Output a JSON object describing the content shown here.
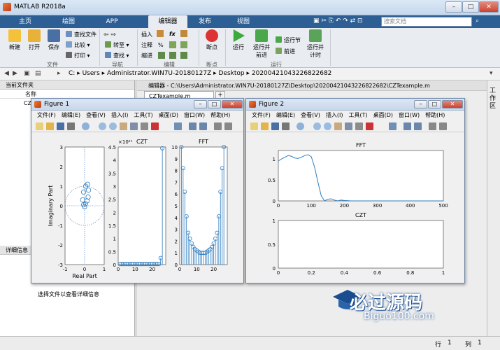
{
  "window": {
    "title": "MATLAB R2018a"
  },
  "ribbon_tabs": [
    {
      "label": "主页"
    },
    {
      "label": "绘图"
    },
    {
      "label": "APP"
    },
    {
      "label": "编辑器"
    },
    {
      "label": "发布"
    },
    {
      "label": "视图"
    }
  ],
  "search": {
    "placeholder": "搜索文档"
  },
  "ribbon": {
    "file": {
      "new": "新建",
      "open": "打开",
      "save": "保存",
      "find_files": "查找文件",
      "compare": "比较",
      "print": "打印",
      "group": "文件"
    },
    "nav": {
      "goto": "转至",
      "find": "查找",
      "group": "导航"
    },
    "edit": {
      "insert": "插入",
      "comment": "注释",
      "indent": "缩进",
      "fx": "fx",
      "pct": "%",
      "group": "编辑"
    },
    "breakpoints": {
      "label": "断点",
      "group": "断点"
    },
    "run": {
      "run": "运行",
      "run_advance": "运行并\n前进",
      "run_section": "运行节",
      "advance": "前进",
      "run_time": "运行并\n计时",
      "group": "运行"
    }
  },
  "address": {
    "segments": [
      "C:",
      "Users",
      "Administrator.WIN7U-20180127Z",
      "Desktop",
      "20200421043226822682"
    ]
  },
  "left_panel": {
    "header": "当前文件夹",
    "col_name": "名称",
    "item": "CZ",
    "details_header": "详细信息",
    "details_hint": "选择文件以查看详细信息"
  },
  "editor": {
    "header": "编辑器 - C:\\Users\\Administrator.WIN7U-20180127Z\\Desktop\\20200421043226822682\\CZTexample.m",
    "tab": "CZTexample.m",
    "add_tab": "+"
  },
  "right_strip": {
    "label": "工作区"
  },
  "status": {
    "row_label": "行",
    "row": "1",
    "col_label": "列",
    "col": "1"
  },
  "figure1": {
    "title": "Figure 1",
    "menus": [
      "文件(F)",
      "编辑(E)",
      "查看(V)",
      "插入(I)",
      "工具(T)",
      "桌面(D)",
      "窗口(W)",
      "帮助(H)"
    ]
  },
  "figure2": {
    "title": "Figure 2",
    "menus": [
      "文件(F)",
      "编辑(E)",
      "查看(V)",
      "插入(I)",
      "工具(T)",
      "桌面(D)",
      "窗口(W)",
      "帮助(H)"
    ]
  },
  "watermark": {
    "text": "必过源码",
    "sub": "Biguo100.com"
  },
  "chart_data": [
    {
      "type": "scatter",
      "title": "",
      "xlabel": "Real Part",
      "ylabel": "Imaginary Part",
      "xlim": [
        -1,
        1
      ],
      "ylim": [
        -3,
        3
      ],
      "xticks": [
        "-1",
        "0",
        "1"
      ],
      "yticks": [
        "3",
        "2",
        "1",
        "0",
        "-1",
        "-2",
        "-3"
      ],
      "series": [
        {
          "x": [
            0.05,
            0.12,
            0.18,
            0.2,
            0.15,
            0.05,
            -0.05,
            -0.1,
            -0.05,
            0.0
          ],
          "y": [
            0.1,
            0.25,
            0.45,
            0.8,
            1.1,
            1.0,
            0.7,
            0.3,
            0.05,
            -0.05
          ]
        }
      ],
      "annotations": [
        "unit circle (dotted)"
      ]
    },
    {
      "type": "line",
      "title": "CZT",
      "exponent": "×10²¹",
      "ylim": [
        0,
        4.5
      ],
      "xlim": [
        0,
        28
      ],
      "yticks": [
        "4.5",
        "4",
        "3.5",
        "3",
        "2.5",
        "2",
        "1.5",
        "1",
        "0.5",
        "0"
      ],
      "xticks": [
        "0",
        "10",
        "20"
      ],
      "stem": true,
      "x": [
        1,
        2,
        3,
        4,
        5,
        6,
        7,
        8,
        9,
        10,
        11,
        12,
        13,
        14,
        15,
        16,
        17,
        18,
        19,
        20,
        21,
        22,
        23,
        24,
        25,
        26
      ],
      "y": [
        0.02,
        0.02,
        0.02,
        0.02,
        0.02,
        0.02,
        0.02,
        0.02,
        0.02,
        0.02,
        0.02,
        0.02,
        0.02,
        0.02,
        0.02,
        0.02,
        0.02,
        0.02,
        0.02,
        0.02,
        0.02,
        0.02,
        0.02,
        0.02,
        0.25,
        4.45
      ]
    },
    {
      "type": "line",
      "title": "FFT",
      "ylim": [
        0,
        10
      ],
      "xlim": [
        0,
        28
      ],
      "yticks": [
        "10",
        "9",
        "8",
        "7",
        "6",
        "5",
        "4",
        "3",
        "2",
        "1",
        "0"
      ],
      "xticks": [
        "0",
        "10",
        "20"
      ],
      "stem": true,
      "x": [
        1,
        2,
        3,
        4,
        5,
        6,
        7,
        8,
        9,
        10,
        11,
        12,
        13,
        14,
        15,
        16,
        17,
        18,
        19,
        20,
        21,
        22,
        23,
        24,
        25,
        26
      ],
      "y": [
        10,
        8.2,
        6.2,
        4.1,
        2.7,
        2.2,
        1.8,
        1.5,
        1.3,
        1.2,
        1.1,
        1.0,
        1.0,
        1.0,
        1.0,
        1.1,
        1.2,
        1.3,
        1.5,
        1.8,
        2.2,
        2.7,
        4.1,
        6.2,
        8.2,
        10
      ]
    },
    {
      "type": "line",
      "title": "FFT",
      "xlim": [
        0,
        500
      ],
      "ylim": [
        0,
        1.2
      ],
      "xticks": [
        "0",
        "100",
        "200",
        "300",
        "400",
        "500"
      ],
      "yticks": [
        "1",
        "0.5",
        "0"
      ],
      "x": [
        0,
        10,
        20,
        30,
        40,
        50,
        60,
        70,
        80,
        90,
        100,
        110,
        120,
        130,
        140,
        150,
        160,
        170,
        180,
        190,
        200,
        220,
        250,
        300,
        350,
        400,
        450,
        500
      ],
      "y": [
        0.95,
        1.0,
        1.04,
        1.08,
        1.06,
        1.02,
        1.01,
        1.04,
        1.08,
        1.1,
        1.05,
        0.8,
        0.45,
        0.12,
        0.0,
        0.04,
        0.05,
        0.02,
        0.0,
        0.02,
        0.01,
        0.0,
        0.0,
        0.0,
        0.0,
        0.0,
        0.0,
        0.0
      ]
    },
    {
      "type": "line",
      "title": "CZT",
      "xlim": [
        0,
        1
      ],
      "ylim": [
        0,
        1
      ],
      "xticks": [
        "0",
        "0.2",
        "0.4",
        "0.6",
        "0.8",
        "1"
      ],
      "yticks": [
        "1",
        "0.5",
        "0"
      ],
      "x": [],
      "y": []
    }
  ]
}
